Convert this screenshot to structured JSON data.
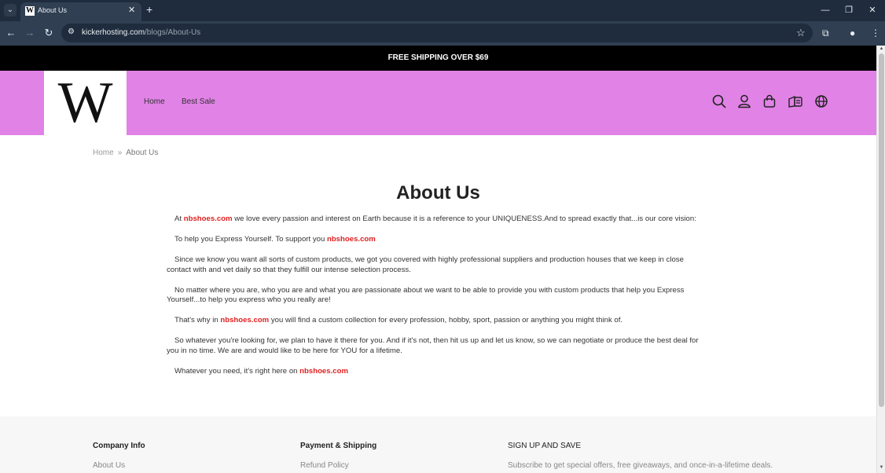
{
  "browser": {
    "tab_title": "About Us",
    "favicon_letter": "W",
    "new_tab": "+",
    "url_domain": "kickerhosting.com",
    "url_path": "/blogs/About-Us"
  },
  "announcement": "FREE SHIPPING OVER $69",
  "header": {
    "logo_text": "W",
    "nav": [
      "Home",
      "Best Sale"
    ],
    "icons": [
      "search-icon",
      "account-icon",
      "cart-icon",
      "shipping-icon",
      "globe-icon"
    ]
  },
  "breadcrumb": {
    "home": "Home",
    "separator": "»",
    "current": "About Us"
  },
  "page_title": "About Us",
  "content": {
    "brand": "nbshoes.com",
    "p1_before": "At ",
    "p1_after": " we love every passion and interest on Earth because it is a reference to your UNIQUENESS.And to spread exactly that...is our core vision:",
    "p2_before": "To help you Express Yourself. To support you ",
    "p3": "Since we know you want all sorts of custom products, we got you covered with highly professional suppliers and production houses that we keep in close contact with and vet daily so that they fulfill our intense selection process.",
    "p4": "No matter where you are, who you are and what you are passionate about we want to be able to provide you with custom products that help you Express Yourself...to help you express who you really are!",
    "p5_before": "That's why in ",
    "p5_after": " you will find a custom collection for every profession, hobby, sport, passion or anything you might think of.",
    "p6": "So whatever you're looking for, we plan to have it there for you. And if it's not, then hit us up and let us know, so we can negotiate or produce the best deal for you in no time. We are and would like to be here for YOU for a lifetime.",
    "p7_before": "Whatever you need, it's right here on "
  },
  "footer": {
    "col1_heading": "Company Info",
    "col1_link": "About Us",
    "col2_heading": "Payment & Shipping",
    "col2_link": "Refund Policy",
    "col3_heading": "SIGN UP AND SAVE",
    "col3_text": "Subscribe to get special offers, free giveaways, and once-in-a-lifetime deals."
  },
  "colors": {
    "header_bg": "#e182e6",
    "announce_bg": "#000000",
    "brand_link": "#e02020",
    "chrome_bg": "#1f2c3d"
  }
}
